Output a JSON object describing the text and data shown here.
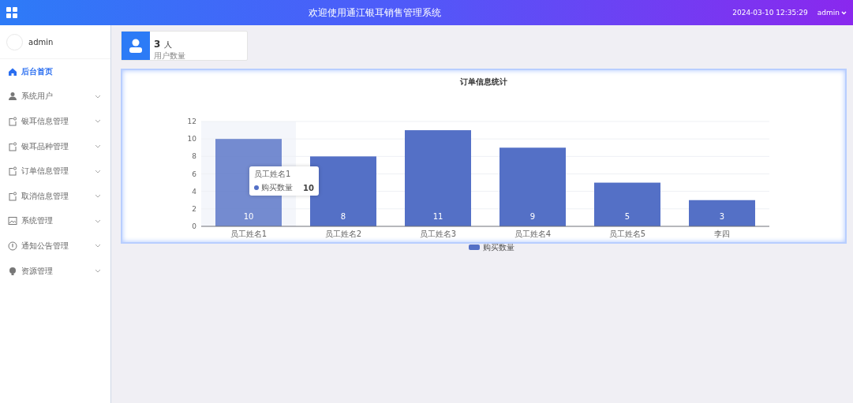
{
  "header": {
    "title": "欢迎使用通江银耳销售管理系统",
    "datetime": "2024-03-10 12:35:29",
    "user": "admin"
  },
  "sidebar": {
    "user": "admin",
    "items": [
      {
        "label": "后台首页",
        "kind": "home",
        "selected": true,
        "expandable": false
      },
      {
        "label": "系统用户",
        "kind": "user",
        "selected": false,
        "expandable": true
      },
      {
        "label": "银耳信息管理",
        "kind": "doc",
        "selected": false,
        "expandable": true
      },
      {
        "label": "银耳品种管理",
        "kind": "doc",
        "selected": false,
        "expandable": true
      },
      {
        "label": "订单信息管理",
        "kind": "doc",
        "selected": false,
        "expandable": true
      },
      {
        "label": "取消信息管理",
        "kind": "doc",
        "selected": false,
        "expandable": true
      },
      {
        "label": "系统管理",
        "kind": "image",
        "selected": false,
        "expandable": true
      },
      {
        "label": "通知公告管理",
        "kind": "info",
        "selected": false,
        "expandable": true
      },
      {
        "label": "资源管理",
        "kind": "bulb",
        "selected": false,
        "expandable": true
      }
    ]
  },
  "stat_card": {
    "value": "3",
    "unit": "人",
    "label": "用户数量"
  },
  "chart_panel": {
    "hovered": [
      true,
      false,
      false,
      false,
      false,
      false
    ],
    "tooltip": {
      "title": "员工姓名1",
      "series": "购买数量",
      "value": "10"
    },
    "chart_data": {
      "type": "bar",
      "title": "订单信息统计",
      "categories": [
        "员工姓名1",
        "员工姓名2",
        "员工姓名3",
        "员工姓名4",
        "员工姓名5",
        "李四"
      ],
      "series": [
        {
          "name": "购买数量",
          "color": "#5470c6",
          "values": [
            10,
            8,
            11,
            9,
            5,
            3
          ]
        }
      ],
      "ylim": [
        0,
        12
      ],
      "grid": true,
      "yticks": [
        0,
        2,
        4,
        6,
        8,
        10,
        12
      ],
      "data_labels": true
    }
  }
}
